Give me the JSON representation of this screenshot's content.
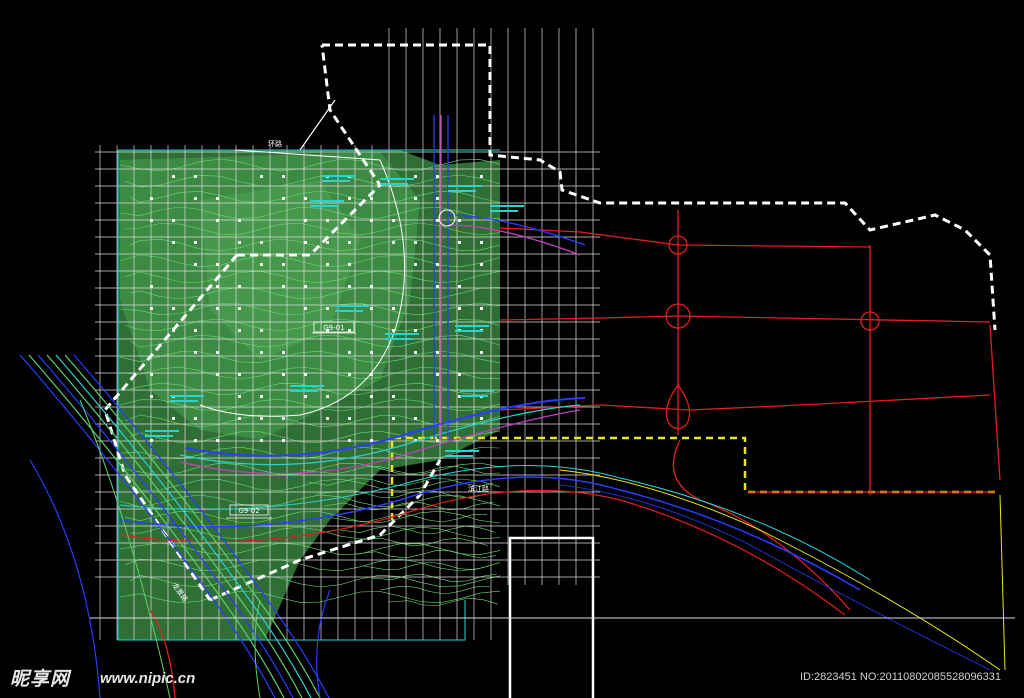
{
  "watermark": {
    "logo": "昵享网",
    "url": "www.nipic.cn",
    "id_text": "ID:2823451 NO:20110802085528096331"
  },
  "labels": {
    "lot_code_1": "G9-01",
    "lot_code_2": "G9-02",
    "road_top": "环路",
    "road_mid": "滨江路",
    "road_left": "龙景路"
  },
  "colors": {
    "background": "#000000",
    "terrain": "#2f7a3a",
    "contour": "#5fd06a",
    "grid": "#e8e8e8",
    "boundary": "#ffffff",
    "cyan": "#27d3d3",
    "red": "#e02020",
    "blue": "#2a3cff",
    "yellow": "#e6e620",
    "magenta": "#c040c0"
  }
}
